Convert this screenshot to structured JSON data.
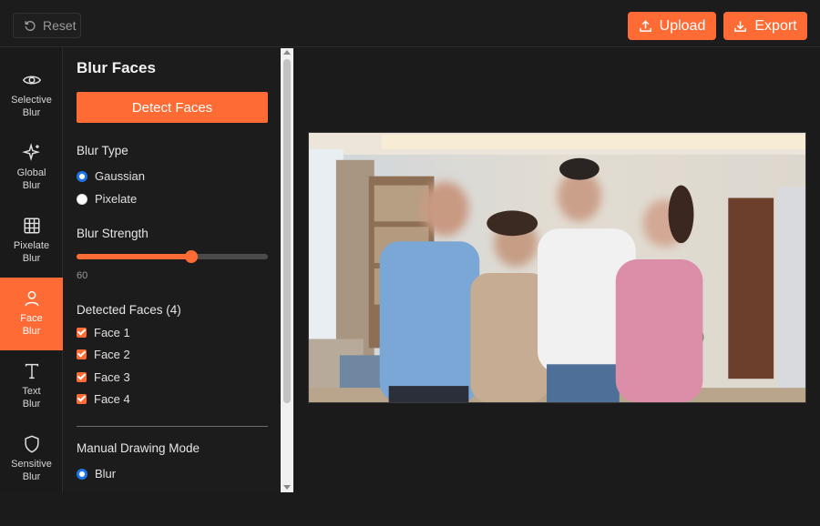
{
  "toolbar": {
    "reset_label": "Reset",
    "upload_label": "Upload",
    "export_label": "Export"
  },
  "tools": [
    {
      "line1": "Selective",
      "line2": "Blur",
      "icon": "eye-icon"
    },
    {
      "line1": "Global",
      "line2": "Blur",
      "icon": "sparkle-icon"
    },
    {
      "line1": "Pixelate",
      "line2": "Blur",
      "icon": "grid-icon"
    },
    {
      "line1": "Face",
      "line2": "Blur",
      "icon": "person-icon",
      "active": true
    },
    {
      "line1": "Text",
      "line2": "Blur",
      "icon": "text-icon"
    },
    {
      "line1": "Sensitive",
      "line2": "Blur",
      "icon": "shield-icon"
    }
  ],
  "panel": {
    "title": "Blur Faces",
    "detect_label": "Detect Faces",
    "blur_type_label": "Blur Type",
    "blur_types": [
      {
        "label": "Gaussian",
        "checked": true
      },
      {
        "label": "Pixelate",
        "checked": false
      }
    ],
    "strength_label": "Blur Strength",
    "strength_value": "60",
    "strength_fraction": 0.6,
    "detected_label": "Detected Faces (4)",
    "faces": [
      "Face 1",
      "Face 2",
      "Face 3",
      "Face 4"
    ],
    "manual_label": "Manual Drawing Mode",
    "manual_options": [
      {
        "label": "Blur",
        "checked": true
      }
    ]
  },
  "colors": {
    "accent": "#ff6b35",
    "radio_selected": "#1e73e8",
    "background": "#1b1b1b"
  }
}
